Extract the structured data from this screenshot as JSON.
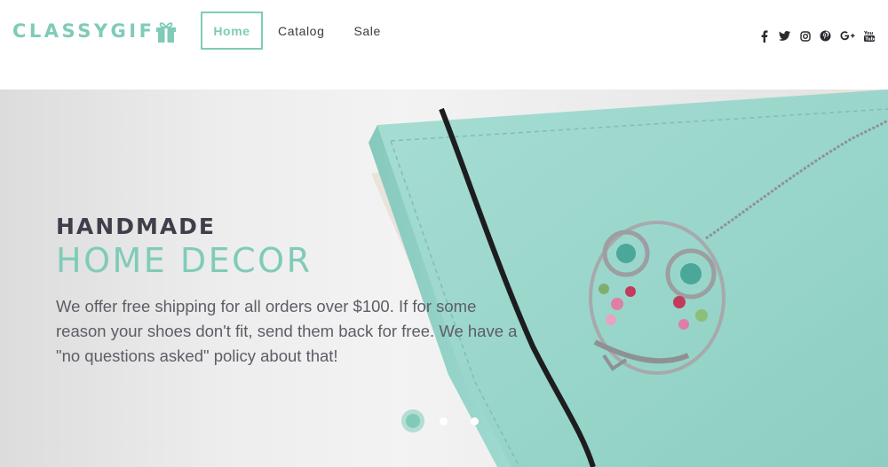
{
  "brand": {
    "logo_text": "CLASSYGIF",
    "logo_icon": "gift-icon",
    "accent_color": "#7fcbb8"
  },
  "nav": {
    "items": [
      {
        "label": "Home",
        "active": true
      },
      {
        "label": "Catalog",
        "active": false
      },
      {
        "label": "Sale",
        "active": false
      }
    ]
  },
  "social": {
    "icons": [
      "facebook-icon",
      "twitter-icon",
      "instagram-icon",
      "pinterest-icon",
      "google-plus-icon",
      "youtube-icon"
    ]
  },
  "hero": {
    "title_line1": "HANDMADE",
    "title_line2": "HOME DECOR",
    "description": "We offer free shipping for all orders over $100. If for some reason your shoes don't fit, send them back for free. We have a \"no questions asked\" policy about that!",
    "slides": 3,
    "active_slide": 1
  }
}
